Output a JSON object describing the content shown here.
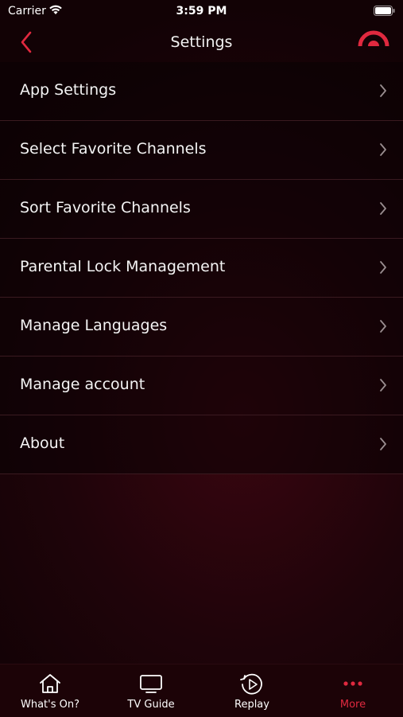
{
  "status_bar": {
    "carrier": "Carrier",
    "time": "3:59 PM"
  },
  "nav": {
    "title": "Settings",
    "back_icon": "chevron-left-icon"
  },
  "menu": [
    {
      "label": "App Settings"
    },
    {
      "label": "Select Favorite Channels"
    },
    {
      "label": "Sort Favorite Channels"
    },
    {
      "label": "Parental Lock Management"
    },
    {
      "label": "Manage Languages"
    },
    {
      "label": "Manage account"
    },
    {
      "label": "About"
    }
  ],
  "tabs": [
    {
      "label": "What's On?",
      "icon": "home-icon"
    },
    {
      "label": "TV Guide",
      "icon": "tv-icon"
    },
    {
      "label": "Replay",
      "icon": "replay-icon"
    },
    {
      "label": "More",
      "icon": "more-dots-icon",
      "active": true
    }
  ],
  "colors": {
    "accent": "#e0293f",
    "background": "#1f040a"
  }
}
